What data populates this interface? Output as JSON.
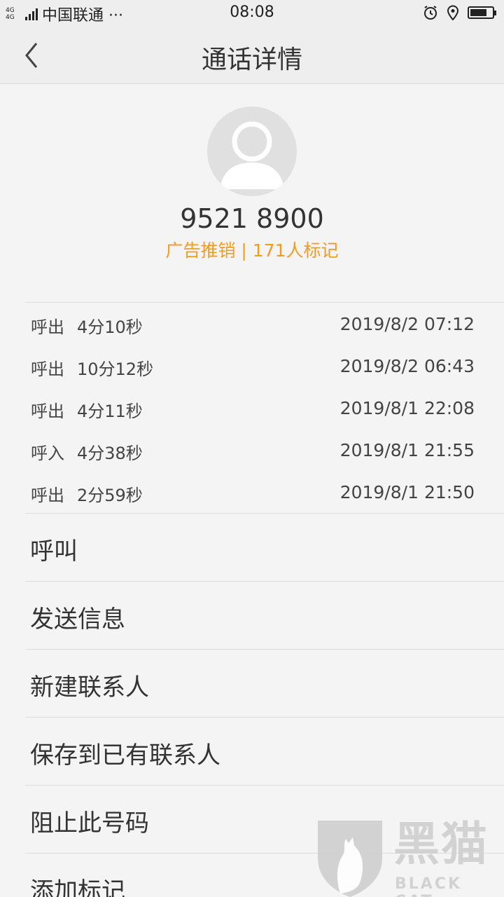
{
  "status_bar": {
    "network": "4G 4G",
    "carrier": "中国联通 ···",
    "time": "08:08",
    "icons": [
      "alarm-icon",
      "location-icon",
      "battery-icon"
    ],
    "battery_level": 0.75
  },
  "nav": {
    "title": "通话详情",
    "back_icon": "chevron-left-icon"
  },
  "contact": {
    "avatar_icon": "person-placeholder-icon",
    "number": "9521 8900",
    "tag": "广告推销 | 171人标记",
    "tag_color": "#f29c1f"
  },
  "calls": [
    {
      "direction": "呼出",
      "duration": "4分10秒",
      "time": "2019/8/2 07:12"
    },
    {
      "direction": "呼出",
      "duration": "10分12秒",
      "time": "2019/8/2 06:43"
    },
    {
      "direction": "呼出",
      "duration": "4分11秒",
      "time": "2019/8/1 22:08"
    },
    {
      "direction": "呼入",
      "duration": "4分38秒",
      "time": "2019/8/1 21:55"
    },
    {
      "direction": "呼出",
      "duration": "2分59秒",
      "time": "2019/8/1 21:50"
    }
  ],
  "actions": [
    "呼叫",
    "发送信息",
    "新建联系人",
    "保存到已有联系人",
    "阻止此号码",
    "添加标记"
  ],
  "watermark": {
    "title": "黑猫",
    "subtitle": "BLACK CAT"
  }
}
